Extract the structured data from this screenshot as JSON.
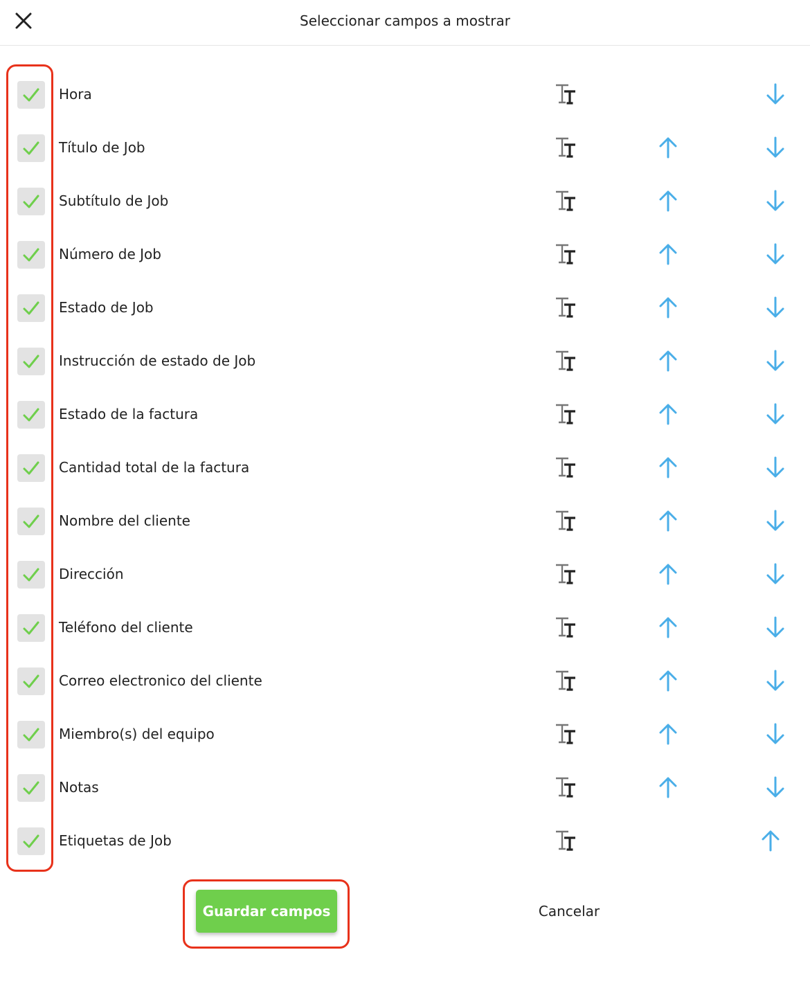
{
  "header": {
    "title": "Seleccionar campos a mostrar",
    "close_icon": "close-icon"
  },
  "colors": {
    "check": "#6fcf4c",
    "arrow": "#4aaee8",
    "highlight": "#e8321b",
    "save_bg": "#6fcf4c"
  },
  "fields": [
    {
      "label": "Hora",
      "checked": true,
      "can_up": false,
      "can_down": true
    },
    {
      "label": "Título de Job",
      "checked": true,
      "can_up": true,
      "can_down": true
    },
    {
      "label": "Subtítulo de Job",
      "checked": true,
      "can_up": true,
      "can_down": true
    },
    {
      "label": "Número de Job",
      "checked": true,
      "can_up": true,
      "can_down": true
    },
    {
      "label": "Estado de Job",
      "checked": true,
      "can_up": true,
      "can_down": true
    },
    {
      "label": "Instrucción de estado de Job",
      "checked": true,
      "can_up": true,
      "can_down": true
    },
    {
      "label": "Estado de la factura",
      "checked": true,
      "can_up": true,
      "can_down": true
    },
    {
      "label": "Cantidad total de la factura",
      "checked": true,
      "can_up": true,
      "can_down": true
    },
    {
      "label": "Nombre del cliente",
      "checked": true,
      "can_up": true,
      "can_down": true
    },
    {
      "label": "Dirección",
      "checked": true,
      "can_up": true,
      "can_down": true
    },
    {
      "label": "Teléfono del cliente",
      "checked": true,
      "can_up": true,
      "can_down": true
    },
    {
      "label": "Correo electronico del cliente",
      "checked": true,
      "can_up": true,
      "can_down": true
    },
    {
      "label": "Miembro(s) del equipo",
      "checked": true,
      "can_up": true,
      "can_down": true
    },
    {
      "label": "Notas",
      "checked": true,
      "can_up": true,
      "can_down": true
    },
    {
      "label": "Etiquetas de Job",
      "checked": true,
      "can_up": true,
      "can_down": false
    }
  ],
  "actions": {
    "save_label": "Guardar campos",
    "cancel_label": "Cancelar"
  }
}
